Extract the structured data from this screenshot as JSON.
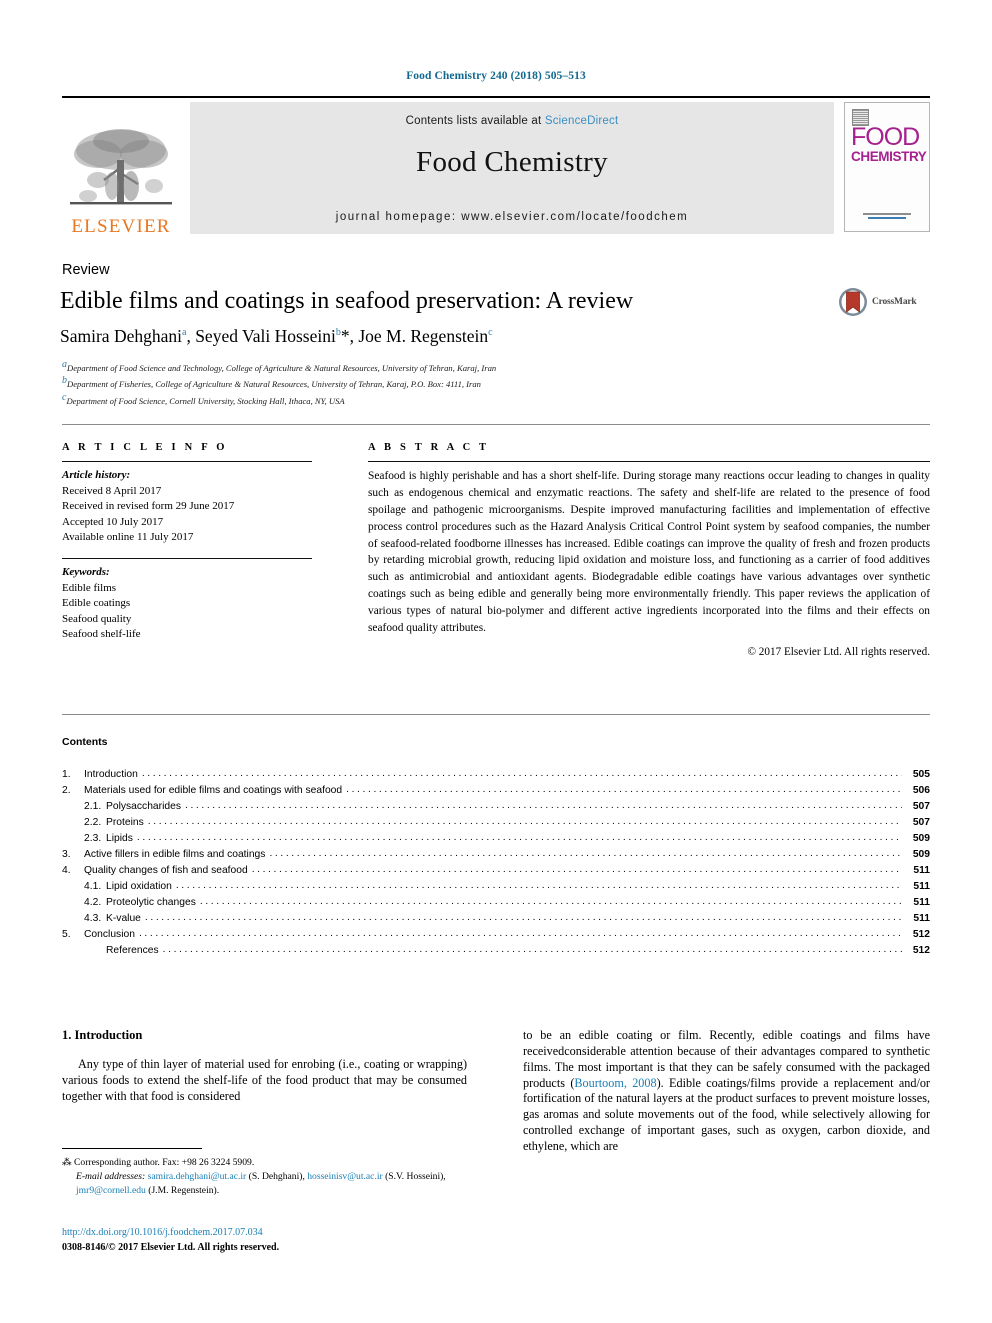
{
  "running_head": "Food Chemistry 240 (2018) 505–513",
  "masthead": {
    "contents_available": "Contents lists available at",
    "sciencedirect": "ScienceDirect",
    "journal_title": "Food Chemistry",
    "journal_homepage": "journal homepage: www.elsevier.com/locate/foodchem",
    "publisher_name": "ELSEVIER",
    "cover": {
      "line1": "FOOD",
      "line2": "CHEMISTRY"
    },
    "accent_color": "#3a8fc4",
    "cover_color": "#a6218f",
    "publisher_color": "#E87722"
  },
  "article": {
    "type": "Review",
    "title": "Edible films and coatings in seafood preservation: A review",
    "authors_html": "Samira Dehghani<sup>a</sup>, Seyed Vali Hosseini<sup>b</sup><span class=\"star\">*</span>, Joe M. Regenstein<sup>c</sup>",
    "affiliations": [
      "a Department of Food Science and Technology, College of Agriculture & Natural Resources, University of Tehran, Karaj, Iran",
      "b Department of Fisheries, College of Agriculture & Natural Resources, University of Tehran, Karaj, P.O. Box: 4111, Iran",
      "c Department of Food Science, Cornell University, Stocking Hall, Ithaca, NY, USA"
    ],
    "crossmark_label": "CrossMark"
  },
  "article_info": {
    "heading": "A R T I C L E   I N F O",
    "history_label": "Article history:",
    "history": [
      "Received 8 April 2017",
      "Received in revised form 29 June 2017",
      "Accepted 10 July 2017",
      "Available online 11 July 2017"
    ],
    "keywords_label": "Keywords:",
    "keywords": [
      "Edible films",
      "Edible coatings",
      "Seafood quality",
      "Seafood shelf-life"
    ]
  },
  "abstract": {
    "heading": "A B S T R A C T",
    "text": "Seafood is highly perishable and has a short shelf-life. During storage many reactions occur leading to changes in quality such as endogenous chemical and enzymatic reactions. The safety and shelf-life are related to the presence of food spoilage and pathogenic microorganisms. Despite improved manufacturing facilities and implementation of effective process control procedures such as the Hazard Analysis Critical Control Point system by seafood companies, the number of seafood-related foodborne illnesses has increased. Edible coatings can improve the quality of fresh and frozen products by retarding microbial growth, reducing lipid oxidation and moisture loss, and functioning as a carrier of food additives such as antimicrobial and antioxidant agents. Biodegradable edible coatings have various advantages over synthetic coatings such as being edible and generally being more environmentally friendly. This paper reviews the application of various types of natural bio-polymer and different active ingredients incorporated into the films and their effects on seafood quality attributes.",
    "copyright": "© 2017 Elsevier Ltd. All rights reserved."
  },
  "contents": {
    "heading": "Contents",
    "items": [
      {
        "num": "1.",
        "label": "Introduction",
        "page": "505",
        "level": 0
      },
      {
        "num": "2.",
        "label": "Materials used for edible films and coatings with seafood",
        "page": "506",
        "level": 0
      },
      {
        "num": "2.1.",
        "label": "Polysaccharides",
        "page": "507",
        "level": 1
      },
      {
        "num": "2.2.",
        "label": "Proteins",
        "page": "507",
        "level": 1
      },
      {
        "num": "2.3.",
        "label": "Lipids",
        "page": "509",
        "level": 1
      },
      {
        "num": "3.",
        "label": "Active fillers in edible films and coatings",
        "page": "509",
        "level": 0
      },
      {
        "num": "4.",
        "label": "Quality changes of fish and seafood",
        "page": "511",
        "level": 0
      },
      {
        "num": "4.1.",
        "label": "Lipid oxidation",
        "page": "511",
        "level": 1
      },
      {
        "num": "4.2.",
        "label": "Proteolytic changes",
        "page": "511",
        "level": 1
      },
      {
        "num": "4.3.",
        "label": "K-value",
        "page": "511",
        "level": 1
      },
      {
        "num": "5.",
        "label": "Conclusion",
        "page": "512",
        "level": 0
      },
      {
        "num": "",
        "label": "References",
        "page": "512",
        "level": 2
      }
    ]
  },
  "body": {
    "section_heading": "1. Introduction",
    "left_paragraph": "Any type of thin layer of material used for enrobing (i.e., coating or wrapping) various foods to extend the shelf-life of the food product that may be consumed together with that food is considered",
    "right_paragraph_1": "to be an edible coating or film. Recently, edible coatings and films have receivedconsiderable attention because of their advantages compared to synthetic films. The most important is that they can be safely consumed with the packaged products (",
    "right_citation": "Bourtoom, 2008",
    "right_paragraph_2": "). Edible coatings/films provide a replacement and/or fortification of the natural layers at the product surfaces to prevent moisture losses, gas aromas and solute movements out of the food, while selectively allowing for controlled exchange of important gases, such as oxygen, carbon dioxide, and ethylene, which are"
  },
  "footnotes": {
    "corresponding": "Corresponding author. Fax: +98 26 3224 5909.",
    "email_label": "E-mail addresses:",
    "email_1": "samira.dehghani@ut.ac.ir",
    "email_1_owner": "(S. Dehghani),",
    "email_2": "hosseinisv@ut.ac.ir",
    "email_2_owner": "(S.V. Hosseini),",
    "email_3": "jmr9@cornell.edu",
    "email_3_owner": "(J.M. Regenstein).",
    "doi": "http://dx.doi.org/10.1016/j.foodchem.2017.07.034",
    "issn_line": "0308-8146/© 2017 Elsevier Ltd. All rights reserved."
  }
}
